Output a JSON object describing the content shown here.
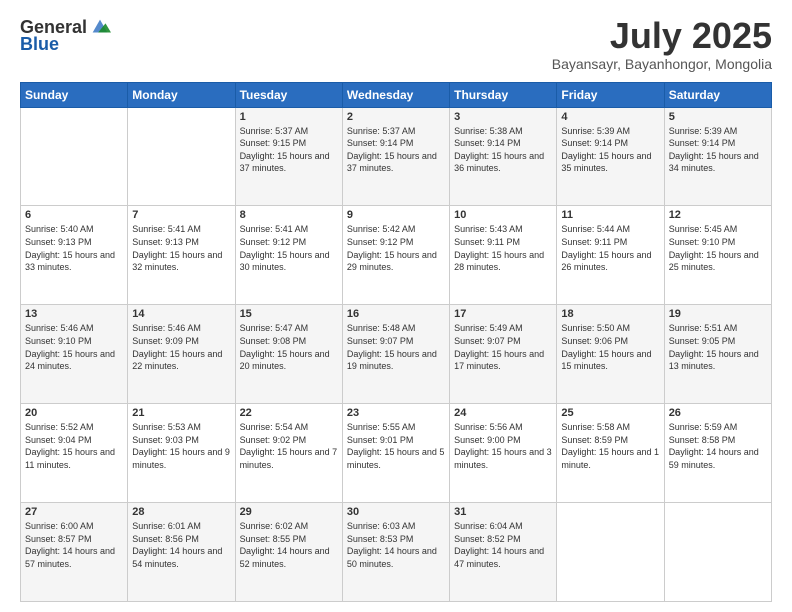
{
  "header": {
    "logo": {
      "general": "General",
      "blue": "Blue"
    },
    "title": "July 2025",
    "subtitle": "Bayansayr, Bayanhongor, Mongolia"
  },
  "calendar": {
    "weekdays": [
      "Sunday",
      "Monday",
      "Tuesday",
      "Wednesday",
      "Thursday",
      "Friday",
      "Saturday"
    ],
    "weeks": [
      [
        {
          "day": "",
          "content": ""
        },
        {
          "day": "",
          "content": ""
        },
        {
          "day": "1",
          "content": "Sunrise: 5:37 AM\nSunset: 9:15 PM\nDaylight: 15 hours and 37 minutes."
        },
        {
          "day": "2",
          "content": "Sunrise: 5:37 AM\nSunset: 9:14 PM\nDaylight: 15 hours and 37 minutes."
        },
        {
          "day": "3",
          "content": "Sunrise: 5:38 AM\nSunset: 9:14 PM\nDaylight: 15 hours and 36 minutes."
        },
        {
          "day": "4",
          "content": "Sunrise: 5:39 AM\nSunset: 9:14 PM\nDaylight: 15 hours and 35 minutes."
        },
        {
          "day": "5",
          "content": "Sunrise: 5:39 AM\nSunset: 9:14 PM\nDaylight: 15 hours and 34 minutes."
        }
      ],
      [
        {
          "day": "6",
          "content": "Sunrise: 5:40 AM\nSunset: 9:13 PM\nDaylight: 15 hours and 33 minutes."
        },
        {
          "day": "7",
          "content": "Sunrise: 5:41 AM\nSunset: 9:13 PM\nDaylight: 15 hours and 32 minutes."
        },
        {
          "day": "8",
          "content": "Sunrise: 5:41 AM\nSunset: 9:12 PM\nDaylight: 15 hours and 30 minutes."
        },
        {
          "day": "9",
          "content": "Sunrise: 5:42 AM\nSunset: 9:12 PM\nDaylight: 15 hours and 29 minutes."
        },
        {
          "day": "10",
          "content": "Sunrise: 5:43 AM\nSunset: 9:11 PM\nDaylight: 15 hours and 28 minutes."
        },
        {
          "day": "11",
          "content": "Sunrise: 5:44 AM\nSunset: 9:11 PM\nDaylight: 15 hours and 26 minutes."
        },
        {
          "day": "12",
          "content": "Sunrise: 5:45 AM\nSunset: 9:10 PM\nDaylight: 15 hours and 25 minutes."
        }
      ],
      [
        {
          "day": "13",
          "content": "Sunrise: 5:46 AM\nSunset: 9:10 PM\nDaylight: 15 hours and 24 minutes."
        },
        {
          "day": "14",
          "content": "Sunrise: 5:46 AM\nSunset: 9:09 PM\nDaylight: 15 hours and 22 minutes."
        },
        {
          "day": "15",
          "content": "Sunrise: 5:47 AM\nSunset: 9:08 PM\nDaylight: 15 hours and 20 minutes."
        },
        {
          "day": "16",
          "content": "Sunrise: 5:48 AM\nSunset: 9:07 PM\nDaylight: 15 hours and 19 minutes."
        },
        {
          "day": "17",
          "content": "Sunrise: 5:49 AM\nSunset: 9:07 PM\nDaylight: 15 hours and 17 minutes."
        },
        {
          "day": "18",
          "content": "Sunrise: 5:50 AM\nSunset: 9:06 PM\nDaylight: 15 hours and 15 minutes."
        },
        {
          "day": "19",
          "content": "Sunrise: 5:51 AM\nSunset: 9:05 PM\nDaylight: 15 hours and 13 minutes."
        }
      ],
      [
        {
          "day": "20",
          "content": "Sunrise: 5:52 AM\nSunset: 9:04 PM\nDaylight: 15 hours and 11 minutes."
        },
        {
          "day": "21",
          "content": "Sunrise: 5:53 AM\nSunset: 9:03 PM\nDaylight: 15 hours and 9 minutes."
        },
        {
          "day": "22",
          "content": "Sunrise: 5:54 AM\nSunset: 9:02 PM\nDaylight: 15 hours and 7 minutes."
        },
        {
          "day": "23",
          "content": "Sunrise: 5:55 AM\nSunset: 9:01 PM\nDaylight: 15 hours and 5 minutes."
        },
        {
          "day": "24",
          "content": "Sunrise: 5:56 AM\nSunset: 9:00 PM\nDaylight: 15 hours and 3 minutes."
        },
        {
          "day": "25",
          "content": "Sunrise: 5:58 AM\nSunset: 8:59 PM\nDaylight: 15 hours and 1 minute."
        },
        {
          "day": "26",
          "content": "Sunrise: 5:59 AM\nSunset: 8:58 PM\nDaylight: 14 hours and 59 minutes."
        }
      ],
      [
        {
          "day": "27",
          "content": "Sunrise: 6:00 AM\nSunset: 8:57 PM\nDaylight: 14 hours and 57 minutes."
        },
        {
          "day": "28",
          "content": "Sunrise: 6:01 AM\nSunset: 8:56 PM\nDaylight: 14 hours and 54 minutes."
        },
        {
          "day": "29",
          "content": "Sunrise: 6:02 AM\nSunset: 8:55 PM\nDaylight: 14 hours and 52 minutes."
        },
        {
          "day": "30",
          "content": "Sunrise: 6:03 AM\nSunset: 8:53 PM\nDaylight: 14 hours and 50 minutes."
        },
        {
          "day": "31",
          "content": "Sunrise: 6:04 AM\nSunset: 8:52 PM\nDaylight: 14 hours and 47 minutes."
        },
        {
          "day": "",
          "content": ""
        },
        {
          "day": "",
          "content": ""
        }
      ]
    ]
  }
}
